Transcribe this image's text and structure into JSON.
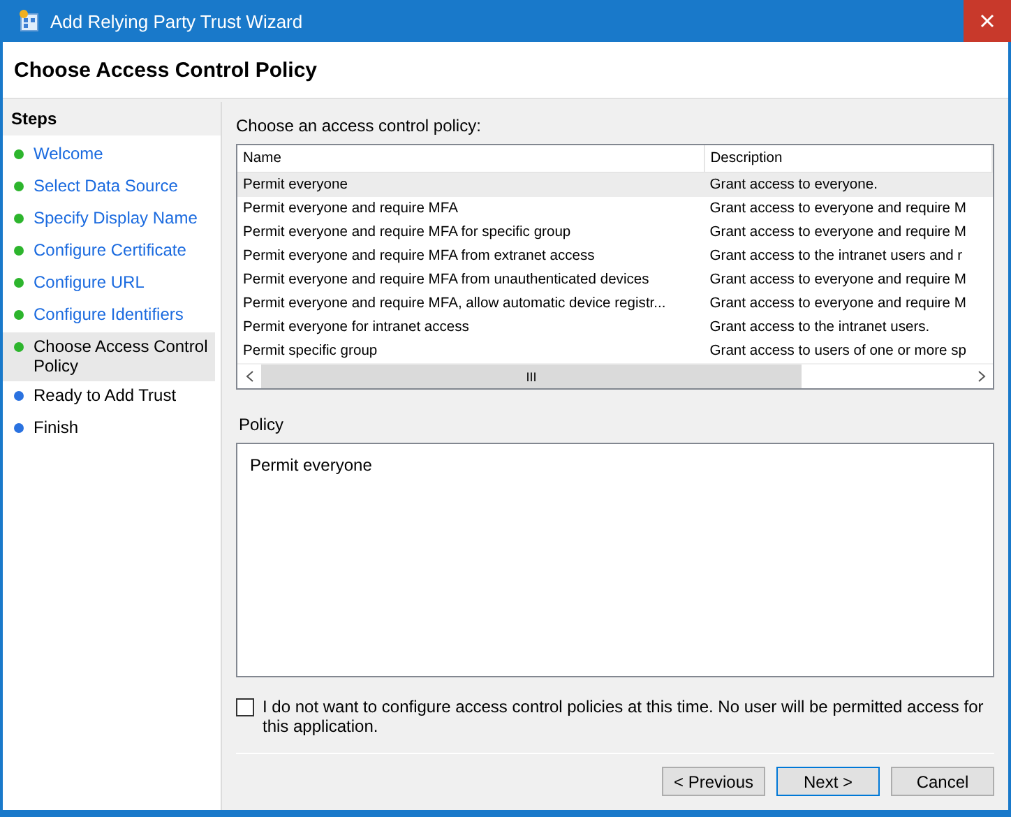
{
  "window": {
    "title": "Add Relying Party Trust Wizard"
  },
  "header": {
    "title": "Choose Access Control Policy"
  },
  "steps": {
    "title": "Steps",
    "items": [
      {
        "label": "Welcome",
        "completed": true,
        "selected": false
      },
      {
        "label": "Select Data Source",
        "completed": true,
        "selected": false
      },
      {
        "label": "Specify Display Name",
        "completed": true,
        "selected": false
      },
      {
        "label": "Configure Certificate",
        "completed": true,
        "selected": false
      },
      {
        "label": "Configure URL",
        "completed": true,
        "selected": false
      },
      {
        "label": "Configure Identifiers",
        "completed": true,
        "selected": false
      },
      {
        "label": "Choose Access Control Policy",
        "completed": true,
        "selected": true
      },
      {
        "label": "Ready to Add Trust",
        "completed": false,
        "selected": false
      },
      {
        "label": "Finish",
        "completed": false,
        "selected": false
      }
    ]
  },
  "policy_list": {
    "label": "Choose an access control policy:",
    "columns": [
      "Name",
      "Description"
    ],
    "rows": [
      {
        "name": "Permit everyone",
        "description": "Grant access to everyone.",
        "selected": true
      },
      {
        "name": "Permit everyone and require MFA",
        "description": "Grant access to everyone and require M",
        "selected": false
      },
      {
        "name": "Permit everyone and require MFA for specific group",
        "description": "Grant access to everyone and require M",
        "selected": false
      },
      {
        "name": "Permit everyone and require MFA from extranet access",
        "description": "Grant access to the intranet users and r",
        "selected": false
      },
      {
        "name": "Permit everyone and require MFA from unauthenticated devices",
        "description": "Grant access to everyone and require M",
        "selected": false
      },
      {
        "name": "Permit everyone and require MFA, allow automatic device registr...",
        "description": "Grant access to everyone and require M",
        "selected": false
      },
      {
        "name": "Permit everyone for intranet access",
        "description": "Grant access to the intranet users.",
        "selected": false
      },
      {
        "name": "Permit specific group",
        "description": "Grant access to users of one or more sp",
        "selected": false
      }
    ],
    "scrollbar_grip": "III"
  },
  "policy": {
    "label": "Policy",
    "value": "Permit everyone"
  },
  "opt_out": {
    "label": "I do not want to configure access control policies at this time. No user will be permitted access for this application.",
    "checked": false
  },
  "buttons": [
    {
      "label": "< Previous",
      "kind": "normal"
    },
    {
      "label": "Next >",
      "kind": "default"
    },
    {
      "label": "Cancel",
      "kind": "normal"
    }
  ]
}
